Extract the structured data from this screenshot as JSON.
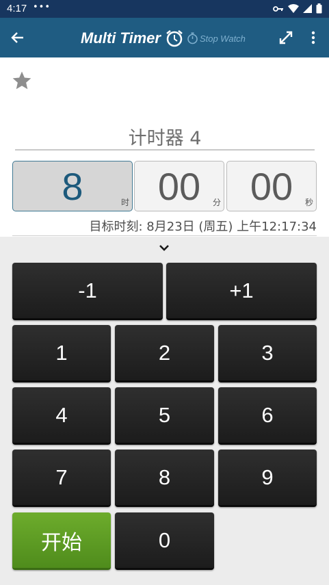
{
  "status_bar": {
    "time": "4:17",
    "dots": "•••"
  },
  "app_bar": {
    "title": "Multi Timer",
    "subtitle": "Stop Watch"
  },
  "timer": {
    "name": "计时器 4",
    "hours": "8",
    "hours_unit": "时",
    "minutes": "00",
    "minutes_unit": "分",
    "seconds": "00",
    "seconds_unit": "秒",
    "target": "目标时刻: 8月23日 (周五) 上午12:17:34"
  },
  "keypad": {
    "minus_one": "-1",
    "plus_one": "+1",
    "digits": [
      "1",
      "2",
      "3",
      "4",
      "5",
      "6",
      "7",
      "8",
      "9",
      "0"
    ],
    "start": "开始"
  },
  "colors": {
    "status_bar": "#17365f",
    "app_bar": "#1f5c82",
    "start_button": "#5f9e25",
    "key": "#262626"
  },
  "icons": [
    "back-arrow-icon",
    "alarm-clock-icon",
    "stopwatch-icon",
    "expand-icon",
    "more-vert-icon",
    "star-icon",
    "chevron-down-icon"
  ]
}
